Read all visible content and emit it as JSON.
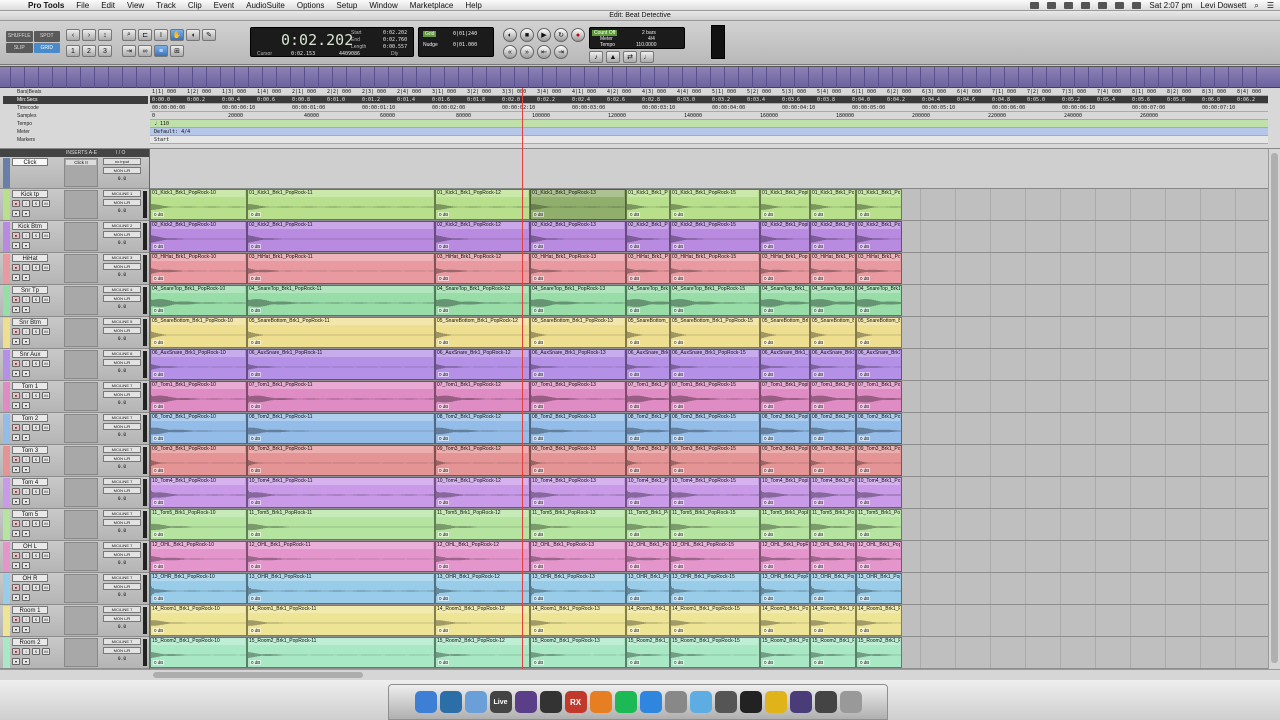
{
  "menubar": {
    "app": "Pro Tools",
    "items": [
      "File",
      "Edit",
      "View",
      "Track",
      "Clip",
      "Event",
      "AudioSuite",
      "Options",
      "Setup",
      "Window",
      "Marketplace",
      "Help"
    ],
    "clock": "Sat 2:07 pm",
    "user": "Levi Dowsett"
  },
  "window_title": "Edit: Beat Detective",
  "toolbar": {
    "modes": [
      "SHUFFLE",
      "SPOT",
      "SLIP",
      "GRID"
    ],
    "main_counter": "0:02.202",
    "start_label": "Start",
    "end_label": "End",
    "length_label": "Length",
    "start_value": "0:02.202",
    "end_value": "0:02.760",
    "length_value": "0:00.557",
    "cursor_label": "Cursor",
    "cursor_value": "0:02.153",
    "cursor_samples": "4409086",
    "dly_label": "Dly",
    "grid_label": "Grid",
    "grid_value": "0|01|240",
    "nudge_label": "Nudge",
    "nudge_value": "0|01.000",
    "count_off": "Count Off",
    "count_value": "2 bars",
    "meter_label": "Meter",
    "meter_value": "4/4",
    "tempo_label": "Tempo",
    "tempo_value": "110.0000"
  },
  "rulers": {
    "labels": [
      "Bars|Beats",
      "Min:Secs",
      "Timecode",
      "Samples",
      "Tempo",
      "Meter",
      "Markers"
    ],
    "bars": [
      "1|1| 000",
      "1|2| 000",
      "1|3| 000",
      "1|4| 000",
      "2|1| 000",
      "2|2| 000",
      "2|3| 000",
      "2|4| 000",
      "3|1| 000",
      "3|2| 000",
      "3|3| 000",
      "3|4| 000",
      "4|1| 000",
      "4|2| 000",
      "4|3| 000",
      "4|4| 000",
      "5|1| 000",
      "5|2| 000",
      "5|3| 000",
      "5|4| 000",
      "6|1| 000",
      "6|2| 000",
      "6|3| 000",
      "6|4| 000",
      "7|1| 000",
      "7|2| 000",
      "7|3| 000",
      "7|4| 000",
      "8|1| 000",
      "8|2| 000",
      "8|3| 000",
      "8|4| 000"
    ],
    "minsecs": [
      "0:00.0",
      "0:00.2",
      "0:00.4",
      "0:00.6",
      "0:00.8",
      "0:01.0",
      "0:01.2",
      "0:01.4",
      "0:01.6",
      "0:01.8",
      "0:02.0",
      "0:02.2",
      "0:02.4",
      "0:02.6",
      "0:02.8",
      "0:03.0",
      "0:03.2",
      "0:03.4",
      "0:03.6",
      "0:03.8",
      "0:04.0",
      "0:04.2",
      "0:04.4",
      "0:04.6",
      "0:04.8",
      "0:05.0",
      "0:05.2",
      "0:05.4",
      "0:05.6",
      "0:05.8",
      "0:06.0",
      "0:06.2"
    ],
    "timecode": [
      "00:00:00:00",
      "00:00:00:10",
      "00:00:01:00",
      "00:00:01:10",
      "00:00:02:00",
      "00:00:02:10",
      "00:00:03:00",
      "00:00:03:10",
      "00:00:04:00",
      "00:00:04:10",
      "00:00:05:00",
      "00:00:05:10",
      "00:00:06:00",
      "00:00:06:10",
      "00:00:07:00",
      "00:00:07:10"
    ],
    "samples": [
      "0",
      "20000",
      "40000",
      "60000",
      "80000",
      "100000",
      "120000",
      "140000",
      "160000",
      "180000",
      "200000",
      "220000",
      "240000",
      "260000"
    ],
    "tempo": "♩ 110",
    "meter": "Default: 4/4",
    "marker": "Start"
  },
  "panel_header": {
    "inserts": "INSERTS A-E",
    "io": "I / O"
  },
  "click_track": {
    "name": "Click",
    "io_in": "no input",
    "io_out": "MON L/R",
    "vol": "0.0",
    "insert": "Click II"
  },
  "clip_starts": [
    0,
    97,
    285,
    380,
    476,
    520,
    610,
    660,
    706
  ],
  "clip_ends": [
    97,
    285,
    380,
    476,
    520,
    610,
    660,
    706,
    752
  ],
  "tracks": [
    {
      "name": "Kick tp",
      "io_in": "MIC/LINE 1",
      "io_out": "MON L/R",
      "vol": "0.0",
      "color": "#b8e08c",
      "base": "01_Kick1_Brk1_PopRock"
    },
    {
      "name": "Kick Btm",
      "io_in": "MIC/LINE 2",
      "io_out": "MON L/R",
      "vol": "0.0",
      "color": "#b88ae0",
      "base": "02_Kick2_Brk1_PopRock"
    },
    {
      "name": "HiHat",
      "io_in": "MIC/LINE 3",
      "io_out": "MON L/R",
      "vol": "0.0",
      "color": "#e89aa0",
      "base": "03_HiHat_Brk1_PopRock"
    },
    {
      "name": "Snr Tp",
      "io_in": "MIC/LINE 4",
      "io_out": "MON L/R",
      "vol": "0.0",
      "color": "#98dca8",
      "base": "04_SnareTop_Brk1_PopRock"
    },
    {
      "name": "Snr Btm",
      "io_in": "MIC/LINE 5",
      "io_out": "MON L/R",
      "vol": "0.0",
      "color": "#eede90",
      "base": "05_SnareBottom_Brk1_PopRock"
    },
    {
      "name": "Snr Aux",
      "io_in": "MIC/LINE 6",
      "io_out": "MON L/R",
      "vol": "0.0",
      "color": "#b490e6",
      "base": "06_AuxSnare_Brk1_PopRock"
    },
    {
      "name": "Tom 1",
      "io_in": "MIC/LINE 7",
      "io_out": "MON L/R",
      "vol": "0.0",
      "color": "#e08cc4",
      "base": "07_Tom1_Brk1_PopRock"
    },
    {
      "name": "Tom 2",
      "io_in": "MIC/LINE 7",
      "io_out": "MON L/R",
      "vol": "0.0",
      "color": "#94bce8",
      "base": "08_Tom2_Brk1_PopRock"
    },
    {
      "name": "Tom 3",
      "io_in": "MIC/LINE 7",
      "io_out": "MON L/R",
      "vol": "0.0",
      "color": "#e49494",
      "base": "09_Tom3_Brk1_PopRock"
    },
    {
      "name": "Tom 4",
      "io_in": "MIC/LINE 7",
      "io_out": "MON L/R",
      "vol": "0.0",
      "color": "#c89ae8",
      "base": "10_Tom4_Brk1_PopRock"
    },
    {
      "name": "Tom 5",
      "io_in": "MIC/LINE 7",
      "io_out": "MON L/R",
      "vol": "0.0",
      "color": "#b4e4a0",
      "base": "11_Tom5_Brk1_PopRock"
    },
    {
      "name": "OH L",
      "io_in": "MIC/LINE 7",
      "io_out": "MON L/R",
      "vol": "0.0",
      "color": "#e496cc",
      "base": "12_OHL_Brk1_PopRock"
    },
    {
      "name": "OH R",
      "io_in": "MIC/LINE 7",
      "io_out": "MON L/R",
      "vol": "0.0",
      "color": "#98cce8",
      "base": "13_OHR_Brk1_PopRock"
    },
    {
      "name": "Room 1",
      "io_in": "MIC/LINE 7",
      "io_out": "MON L/R",
      "vol": "0.0",
      "color": "#eee496",
      "base": "14_Room1_Brk1_PopRock"
    },
    {
      "name": "Room 2",
      "io_in": "MIC/LINE 7",
      "io_out": "MON L/R",
      "vol": "0.0",
      "color": "#a8e8c4",
      "base": "15_Room2_Brk1_PopRock"
    }
  ],
  "clip_suffixes": [
    "-10",
    "-11",
    "-12",
    "-13",
    "-14",
    "-15",
    "-16",
    "-17",
    "-18"
  ],
  "clip_gain": "0 dB",
  "dock": [
    "Finder",
    "Safari",
    "Preview",
    "Live",
    "Pro Tools",
    "Logic",
    "RX",
    "Music",
    "Spotify",
    "iTunes",
    "Utility",
    "Preview",
    "Activity",
    "Terminal",
    "Chrome",
    "Pro Tools",
    "Notes",
    "Trash"
  ],
  "dock_labels": [
    "Live",
    "RX"
  ],
  "colors": {
    "playhead": "#e04040",
    "universe": "#7c72aa",
    "selection": "#3a3a3a"
  }
}
